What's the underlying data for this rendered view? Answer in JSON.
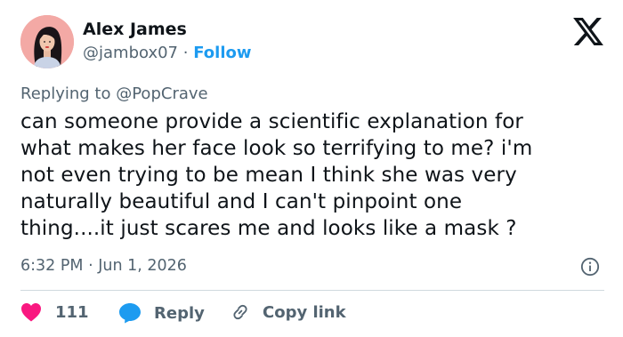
{
  "user": {
    "name": "Alex James",
    "handle": "@jambox07",
    "separator": "·",
    "follow_label": "Follow"
  },
  "logo_icon": "x-logo-icon",
  "reply_context": {
    "prefix": "Replying to",
    "mention": "@PopCrave"
  },
  "tweet": {
    "lines": [
      "can someone provide a scientific explanation for",
      "what makes her face look so terrifying to me? i'm",
      "not even trying to be mean I think she was very",
      "naturally beautiful and I can't pinpoint one",
      "thing....it just scares me and looks like a mask ?"
    ]
  },
  "meta": {
    "timestamp": "6:32 PM · Jun 1, 2026",
    "info_icon": "info-icon"
  },
  "actions": {
    "like_count": "111",
    "reply_label": "Reply",
    "copy_link_label": "Copy link"
  },
  "colors": {
    "text": "#0f1419",
    "secondary": "#536471",
    "accent_blue": "#1d9bf0",
    "like_red": "#f91880",
    "divider": "#cfd9de",
    "avatar_bg": "#f3a9a5"
  }
}
